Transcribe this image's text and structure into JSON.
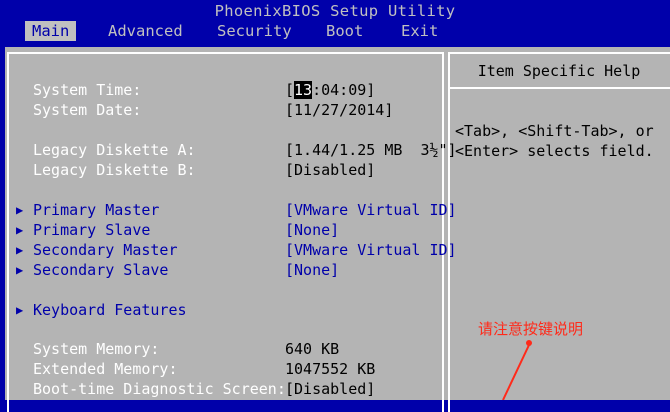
{
  "title": "PhoenixBIOS Setup Utility",
  "menu": [
    {
      "label": "Main",
      "active": true
    },
    {
      "label": "Advanced",
      "active": false
    },
    {
      "label": "Security",
      "active": false
    },
    {
      "label": "Boot",
      "active": false
    },
    {
      "label": "Exit",
      "active": false
    }
  ],
  "main": {
    "system_time": {
      "label": "System Time:",
      "value_open": "[",
      "value_cursor": "13",
      "value_rest": ":04:09]"
    },
    "system_date": {
      "label": "System Date:",
      "value": "[11/27/2014]"
    },
    "diskette_a": {
      "label": "Legacy Diskette A:",
      "value": "[1.44/1.25 MB  3½\"]"
    },
    "diskette_b": {
      "label": "Legacy Diskette B:",
      "value": "[Disabled]"
    },
    "submenus": [
      {
        "label": "Primary Master",
        "value": "[VMware Virtual ID]"
      },
      {
        "label": "Primary Slave",
        "value": "[None]"
      },
      {
        "label": "Secondary Master",
        "value": "[VMware Virtual ID]"
      },
      {
        "label": "Secondary Slave",
        "value": "[None]"
      }
    ],
    "keyboard": {
      "label": "Keyboard Features"
    },
    "system_memory": {
      "label": "System Memory:",
      "value": "640 KB"
    },
    "extended_memory": {
      "label": "Extended Memory:",
      "value": "1047552 KB"
    },
    "boot_diag": {
      "label": "Boot-time Diagnostic Screen:",
      "value": "[Disabled]"
    }
  },
  "help": {
    "title": "Item Specific Help",
    "line1": "<Tab>, <Shift-Tab>, or",
    "line2": "<Enter> selects field."
  },
  "annotation": {
    "text": "请注意按键说明",
    "color": "#ff2a1a"
  },
  "colors": {
    "bios_blue": "#0000aa",
    "panel_gray": "#b4b4b4"
  },
  "icons": {
    "submenu_marker": "triangle-right-icon"
  }
}
